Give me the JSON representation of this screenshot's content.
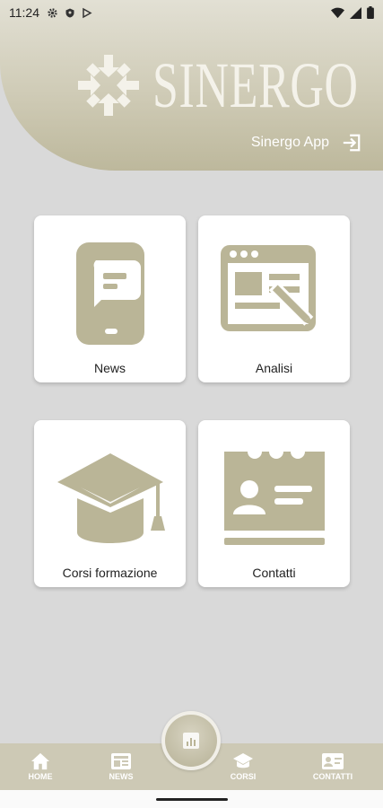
{
  "status_bar": {
    "time": "11:24",
    "icons": [
      "gear-icon",
      "shield-icon",
      "play-store-icon"
    ],
    "right_icons": [
      "wifi-icon",
      "signal-icon",
      "battery-icon"
    ]
  },
  "header": {
    "logo_text": "SINERGO",
    "app_label": "Sinergo App",
    "login_icon": "login-icon"
  },
  "cards": {
    "news": {
      "label": "News",
      "icon": "phone-chat-icon"
    },
    "analisi": {
      "label": "Analisi",
      "icon": "form-pencil-icon"
    },
    "corsi": {
      "label": "Corsi formazione",
      "icon": "graduation-cap-icon"
    },
    "contatti": {
      "label": "Contatti",
      "icon": "contact-card-icon"
    }
  },
  "bottom_nav": {
    "home": "HOME",
    "news": "NEWS",
    "corsi": "CORSI",
    "contatti": "CONTATTI",
    "center_icon": "chart-icon"
  },
  "colors": {
    "accent": "#b9b496",
    "background": "#d9d9d9",
    "card": "#ffffff"
  }
}
